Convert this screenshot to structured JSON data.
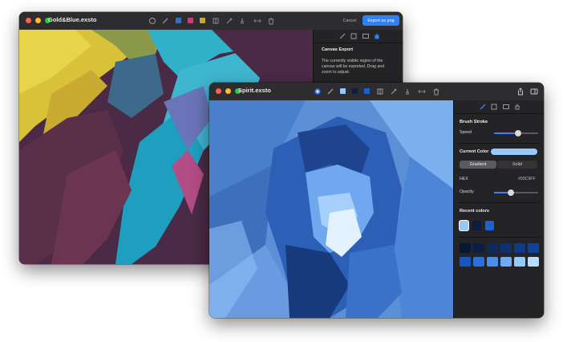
{
  "back_window": {
    "title": "Gold&Blue.exsto",
    "cancel_label": "Cancel",
    "export_label": "Export as png",
    "panel": {
      "heading": "Canvas Export",
      "description": "The currently visible region of the canvas will be exported. Drag and zoom to adjust."
    },
    "toolbar_swatches": [
      "#2f6fd0",
      "#c0427d",
      "#c9a43b"
    ]
  },
  "front_window": {
    "title": "Spirit.exsto",
    "brush_stroke": {
      "heading": "Brush Stroke",
      "speed_label": "Speed",
      "speed_value": 0.55
    },
    "current_color": {
      "label": "Current Color",
      "value": "#93C9FF",
      "gradient_label": "Gradient",
      "solid_label": "Solid",
      "hex_label": "HEX",
      "hex_value": "#93C9FF",
      "opacity_label": "Opacity",
      "opacity_value": 0.38
    },
    "recent_colors": {
      "heading": "Recent colors",
      "colors": [
        "#93c9ff",
        "#0a1d45",
        "#1e5fd2"
      ]
    },
    "palette": {
      "dark_row": [
        "#081733",
        "#0b1f45",
        "#0d2a5c",
        "#0e3070",
        "#0f3a86",
        "#12439a"
      ],
      "light_row": [
        "#1556c2",
        "#2a6fdc",
        "#4a8ff0",
        "#6eaaf6",
        "#93c9ff",
        "#b6dcff"
      ]
    }
  }
}
